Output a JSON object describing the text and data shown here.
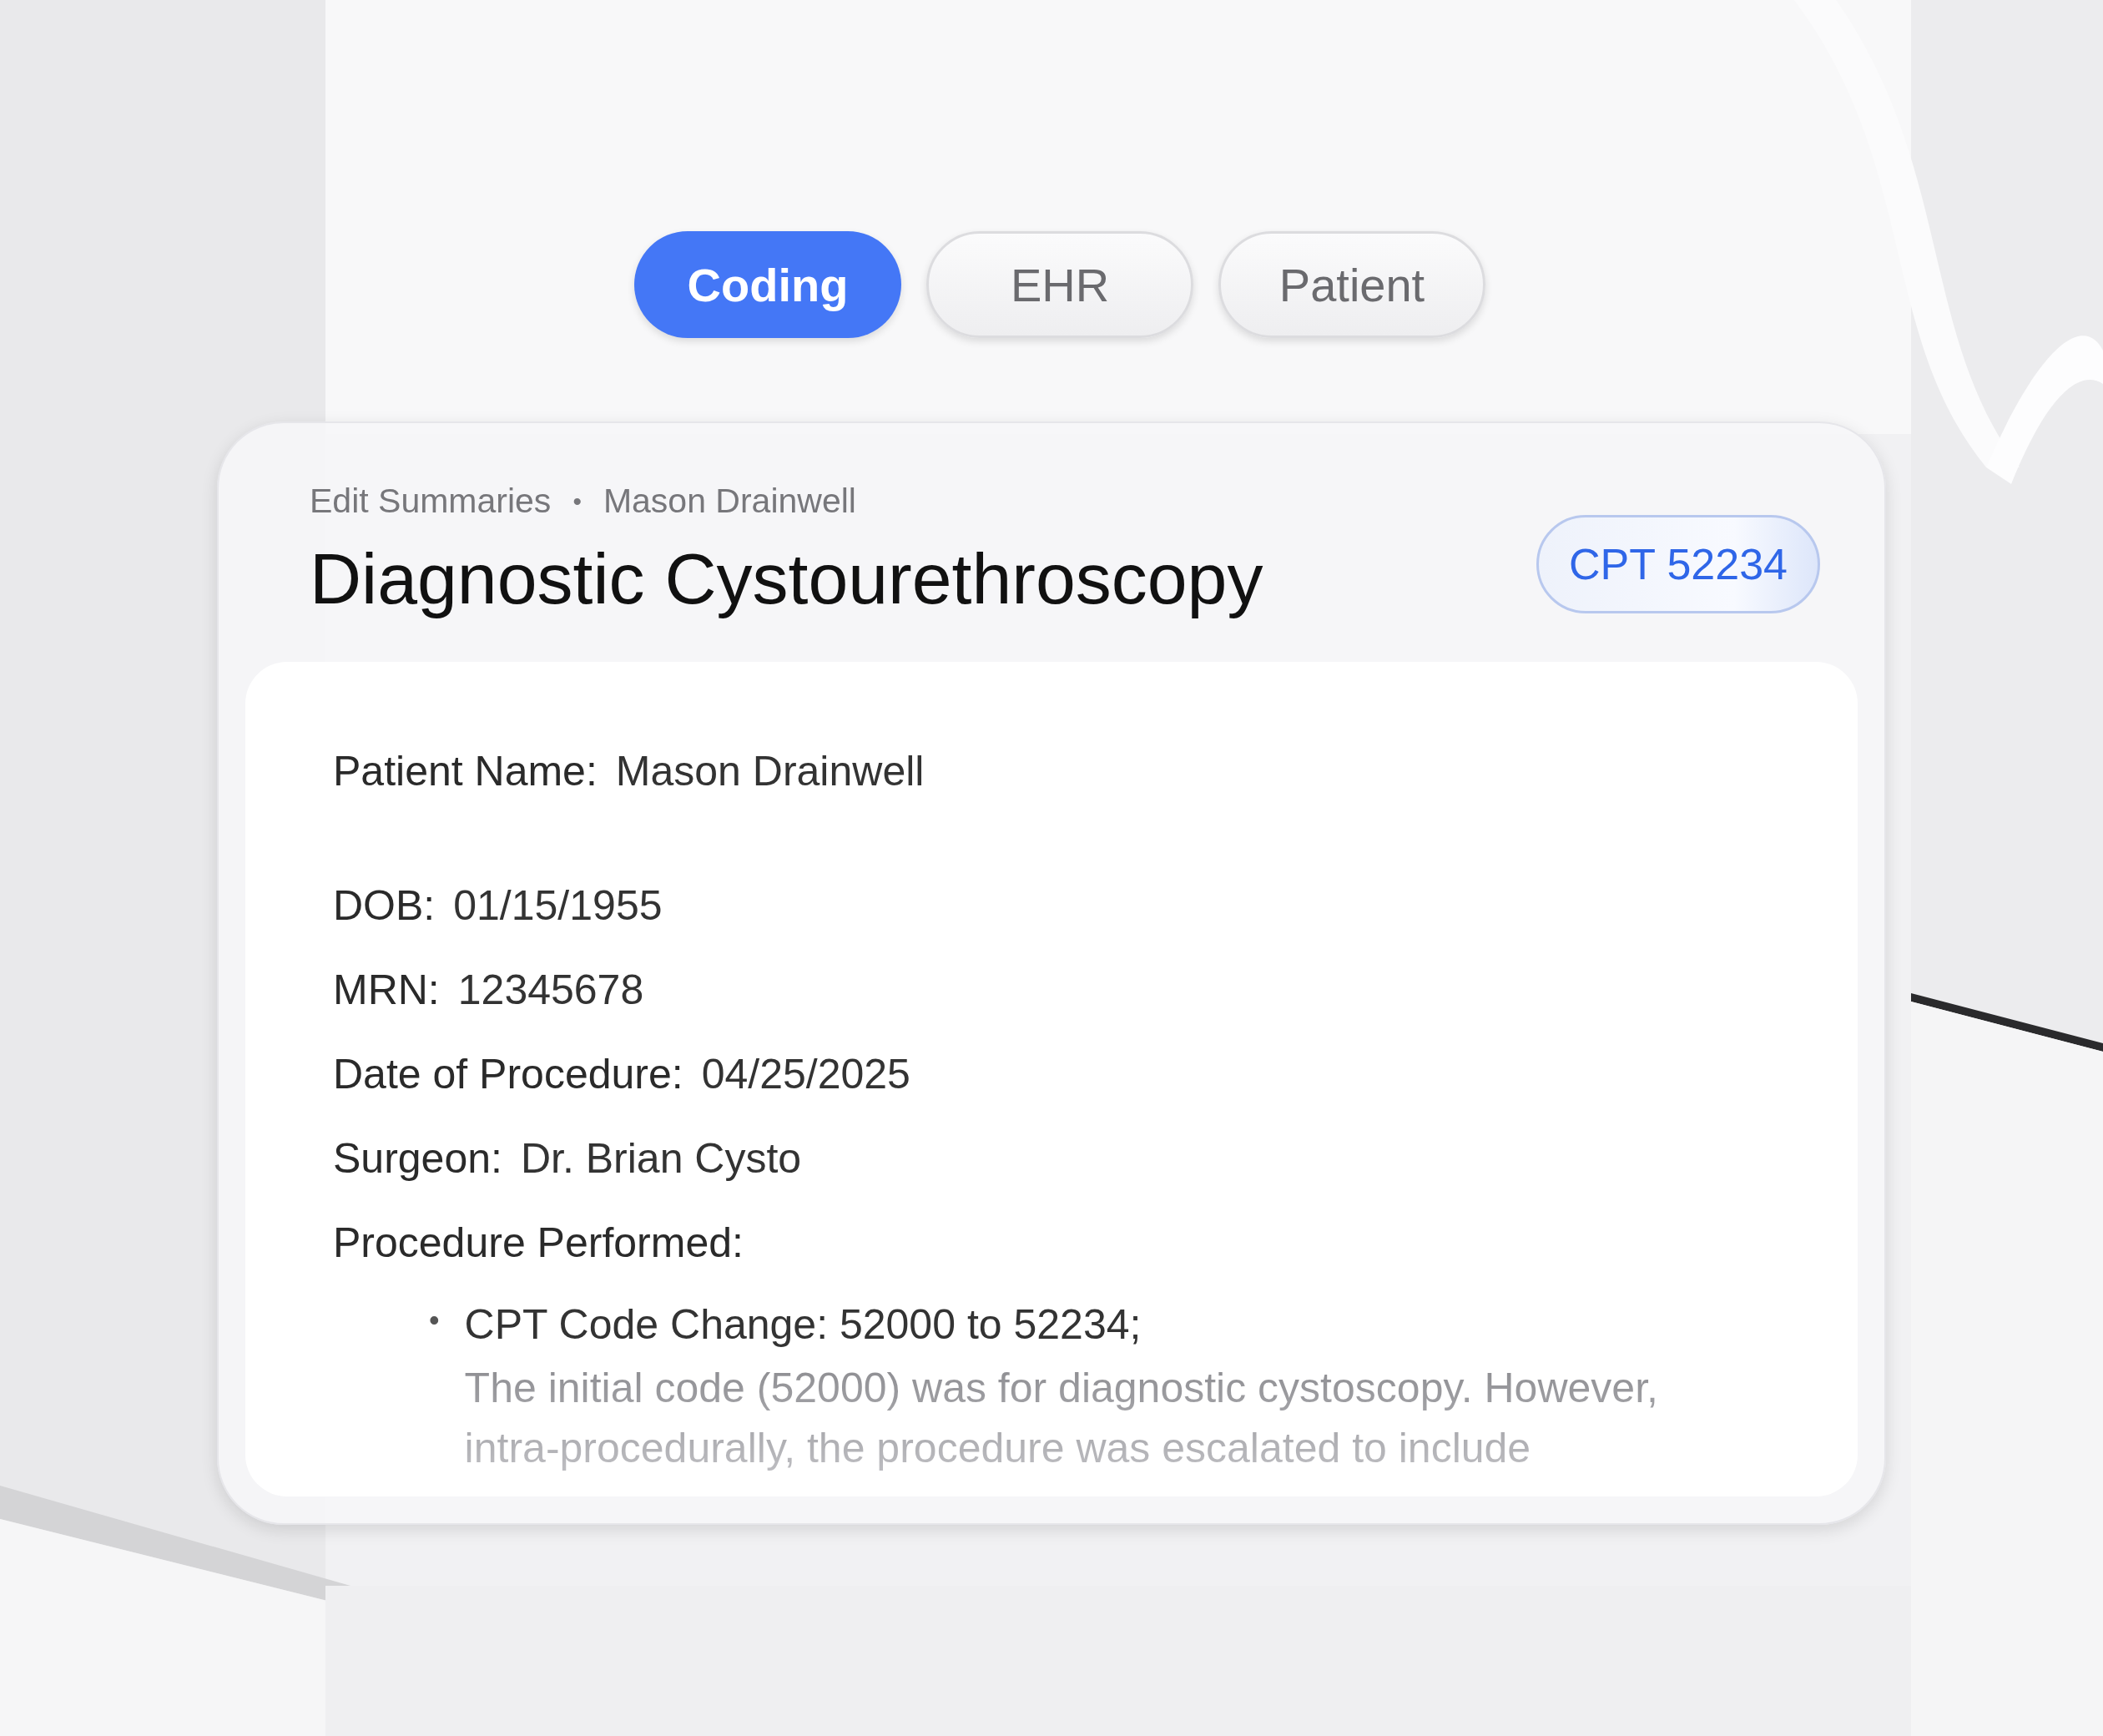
{
  "tabs": [
    {
      "label": "Coding",
      "selected": true
    },
    {
      "label": "EHR",
      "selected": false
    },
    {
      "label": "Patient",
      "selected": false
    }
  ],
  "card": {
    "breadcrumb": [
      "Edit Summaries",
      "Mason Drainwell"
    ],
    "breadcrumb_separator": "•",
    "title": "Diagnostic Cystourethroscopy",
    "badge": "CPT 52234",
    "patient": {
      "label": "Patient Name:",
      "value": "Mason Drainwell"
    },
    "fields": [
      {
        "label": "DOB:",
        "value": "01/15/1955"
      },
      {
        "label": "MRN:",
        "value": "12345678"
      },
      {
        "label": "Date of Procedure:",
        "value": "04/25/2025"
      },
      {
        "label": "Surgeon:",
        "value": "Dr. Brian Cysto"
      }
    ],
    "procedure": {
      "label": "Procedure Performed:",
      "items": [
        {
          "bullet": "•",
          "heading": "CPT Code Change: 52000 to 52234;",
          "description": "The initial code (52000) was for diagnostic cystoscopy. However,\nintra-procedurally, the procedure was escalated to include"
        }
      ]
    }
  }
}
